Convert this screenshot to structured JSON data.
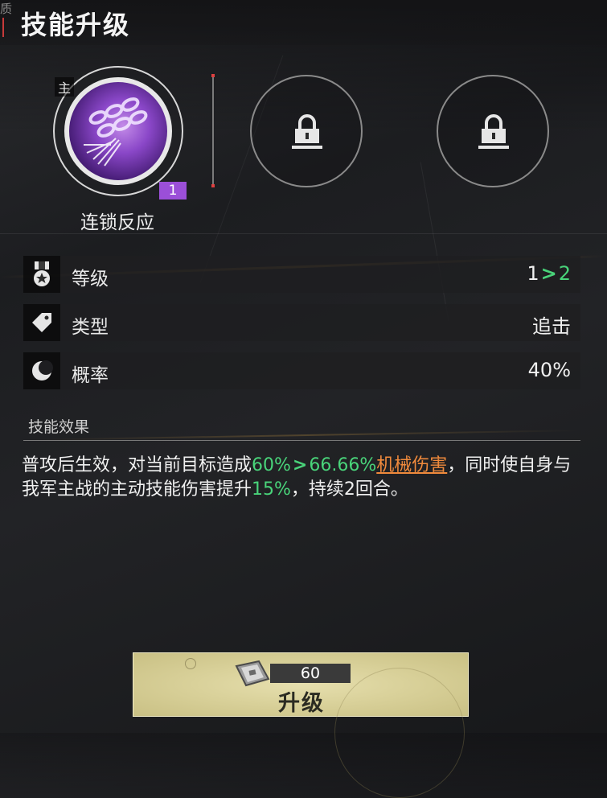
{
  "header": {
    "edge_glyph": "质",
    "title": "技能升级"
  },
  "skill_slots": {
    "main": {
      "tag": "主",
      "name": "连锁反应",
      "level_badge": "1",
      "icon": "chain-skill-icon"
    },
    "locked": [
      {
        "icon": "lock-icon"
      },
      {
        "icon": "lock-icon"
      }
    ]
  },
  "stats": [
    {
      "icon": "medal-icon",
      "label": "等级",
      "value_from": "1",
      "arrow": ">",
      "value_to": "2"
    },
    {
      "icon": "tag-icon",
      "label": "类型",
      "value": "追击"
    },
    {
      "icon": "moon-icon",
      "label": "概率",
      "value": "40%"
    }
  ],
  "effect": {
    "title": "技能效果",
    "text_1": "普攻后生效，对当前目标造成",
    "pct_from": "60%",
    "arrow": ">",
    "pct_to": "66.66%",
    "dmg_type": "机械伤害",
    "text_2": "，同时使自身与我军主战的主动技能伤害提升",
    "boost": "15%",
    "text_3": "，持续2回合。"
  },
  "upgrade": {
    "cost": "60",
    "label": "升级",
    "icon": "chip-item-icon"
  },
  "colors": {
    "accent_green": "#49d47a",
    "accent_orange": "#f08a3c",
    "badge_purple": "#9b4fd8",
    "button_bg": "#d9d19a"
  }
}
